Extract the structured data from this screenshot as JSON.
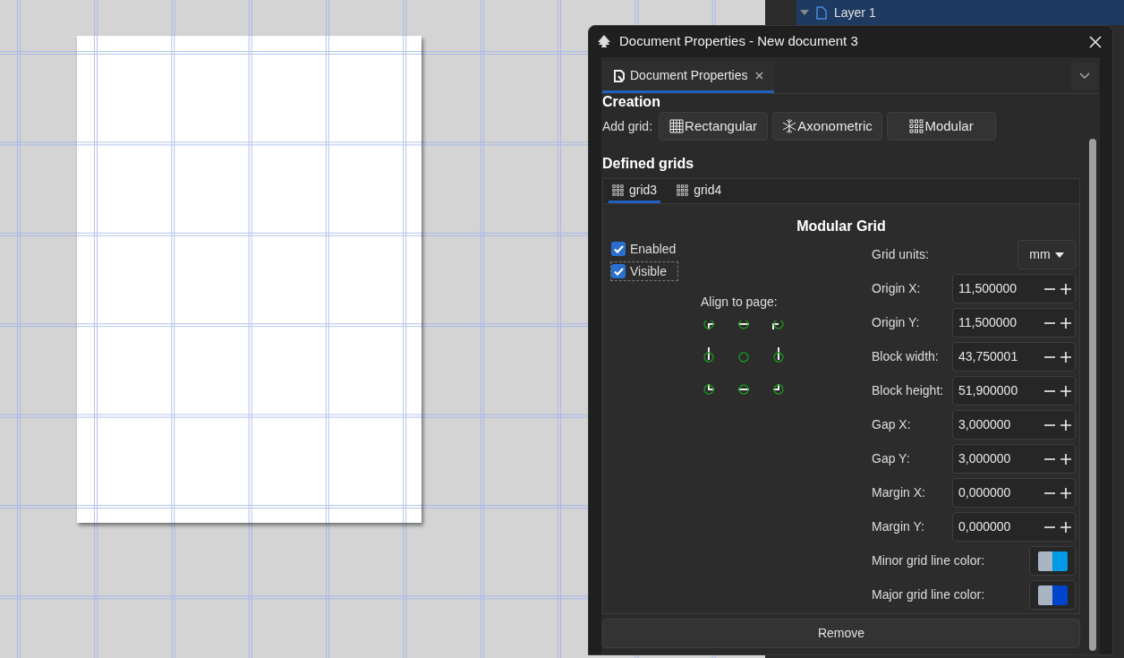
{
  "layers_panel": {
    "layer": {
      "name": "Layer 1",
      "expanded": true
    }
  },
  "dialog": {
    "title": "Document Properties - New document 3",
    "tabs": [
      {
        "label": "Document Properties",
        "selected": true
      }
    ],
    "creation": {
      "heading": "Creation",
      "add_grid_label": "Add grid:",
      "buttons": [
        {
          "kind": "rectangular",
          "label": "Rectangular"
        },
        {
          "kind": "axonometric",
          "label": "Axonometric"
        },
        {
          "kind": "modular",
          "label": "Modular"
        }
      ]
    },
    "defined_grids": {
      "heading": "Defined grids",
      "tabs": [
        {
          "label": "grid3",
          "selected": true
        },
        {
          "label": "grid4",
          "selected": false
        }
      ],
      "title": "Modular Grid",
      "checkboxes": [
        {
          "label": "Enabled",
          "checked": true,
          "focused": false
        },
        {
          "label": "Visible",
          "checked": true,
          "focused": true
        }
      ],
      "align_label": "Align to page:",
      "fields": [
        {
          "kind": "dropdown",
          "label": "Grid units:",
          "value": "mm"
        },
        {
          "kind": "number",
          "label": "Origin X:",
          "value": "11,500000"
        },
        {
          "kind": "number",
          "label": "Origin Y:",
          "value": "11,500000"
        },
        {
          "kind": "number",
          "label": "Block width:",
          "value": "43,750001"
        },
        {
          "kind": "number",
          "label": "Block height:",
          "value": "51,900000"
        },
        {
          "kind": "number",
          "label": "Gap X:",
          "value": "3,000000"
        },
        {
          "kind": "number",
          "label": "Gap Y:",
          "value": "3,000000"
        },
        {
          "kind": "number",
          "label": "Margin X:",
          "value": "0,000000"
        },
        {
          "kind": "number",
          "label": "Margin Y:",
          "value": "0,000000"
        },
        {
          "kind": "color",
          "label": "Minor grid line color:",
          "color": "#0099e5"
        },
        {
          "kind": "color",
          "label": "Major grid line color:",
          "color": "#0044cc"
        }
      ]
    },
    "remove_button": "Remove"
  }
}
